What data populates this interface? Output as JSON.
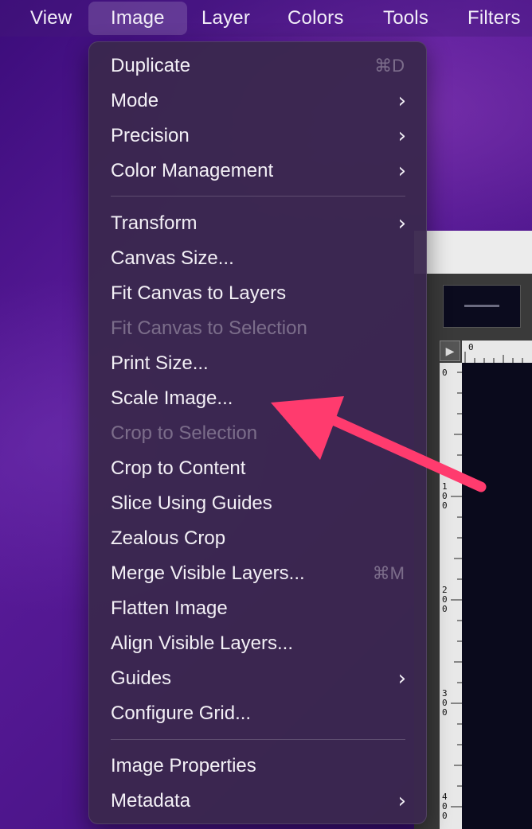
{
  "menubar": {
    "items": [
      "View",
      "Image",
      "Layer",
      "Colors",
      "Tools",
      "Filters"
    ]
  },
  "image_menu": {
    "items": [
      {
        "label": "Duplicate",
        "shortcut": "⌘D",
        "submenu": false,
        "enabled": true
      },
      {
        "label": "Mode",
        "shortcut": "",
        "submenu": true,
        "enabled": true
      },
      {
        "label": "Precision",
        "shortcut": "",
        "submenu": true,
        "enabled": true
      },
      {
        "label": "Color Management",
        "shortcut": "",
        "submenu": true,
        "enabled": true
      },
      {
        "label": "Transform",
        "shortcut": "",
        "submenu": true,
        "enabled": true
      },
      {
        "label": "Canvas Size...",
        "shortcut": "",
        "submenu": false,
        "enabled": true
      },
      {
        "label": "Fit Canvas to Layers",
        "shortcut": "",
        "submenu": false,
        "enabled": true
      },
      {
        "label": "Fit Canvas to Selection",
        "shortcut": "",
        "submenu": false,
        "enabled": false
      },
      {
        "label": "Print Size...",
        "shortcut": "",
        "submenu": false,
        "enabled": true
      },
      {
        "label": "Scale Image...",
        "shortcut": "",
        "submenu": false,
        "enabled": true
      },
      {
        "label": "Crop to Selection",
        "shortcut": "",
        "submenu": false,
        "enabled": false
      },
      {
        "label": "Crop to Content",
        "shortcut": "",
        "submenu": false,
        "enabled": true
      },
      {
        "label": "Slice Using Guides",
        "shortcut": "",
        "submenu": false,
        "enabled": true
      },
      {
        "label": "Zealous Crop",
        "shortcut": "",
        "submenu": false,
        "enabled": true
      },
      {
        "label": "Merge Visible Layers...",
        "shortcut": "⌘M",
        "submenu": false,
        "enabled": true
      },
      {
        "label": "Flatten Image",
        "shortcut": "",
        "submenu": false,
        "enabled": true
      },
      {
        "label": "Align Visible Layers...",
        "shortcut": "",
        "submenu": false,
        "enabled": true
      },
      {
        "label": "Guides",
        "shortcut": "",
        "submenu": true,
        "enabled": true
      },
      {
        "label": "Configure Grid...",
        "shortcut": "",
        "submenu": false,
        "enabled": true
      },
      {
        "label": "Image Properties",
        "shortcut": "",
        "submenu": false,
        "enabled": true
      },
      {
        "label": "Metadata",
        "shortcut": "",
        "submenu": true,
        "enabled": true
      }
    ]
  },
  "ruler": {
    "h_label": "0",
    "v_labels": [
      "0",
      "100",
      "200",
      "300",
      "400"
    ]
  },
  "icons": {
    "submenu": "chevron-right-icon",
    "navigate": "play-triangle-icon"
  },
  "colors": {
    "arrow": "#ff3b6e",
    "menu_bg": "#3a284e",
    "desktop": "#4a1488"
  }
}
